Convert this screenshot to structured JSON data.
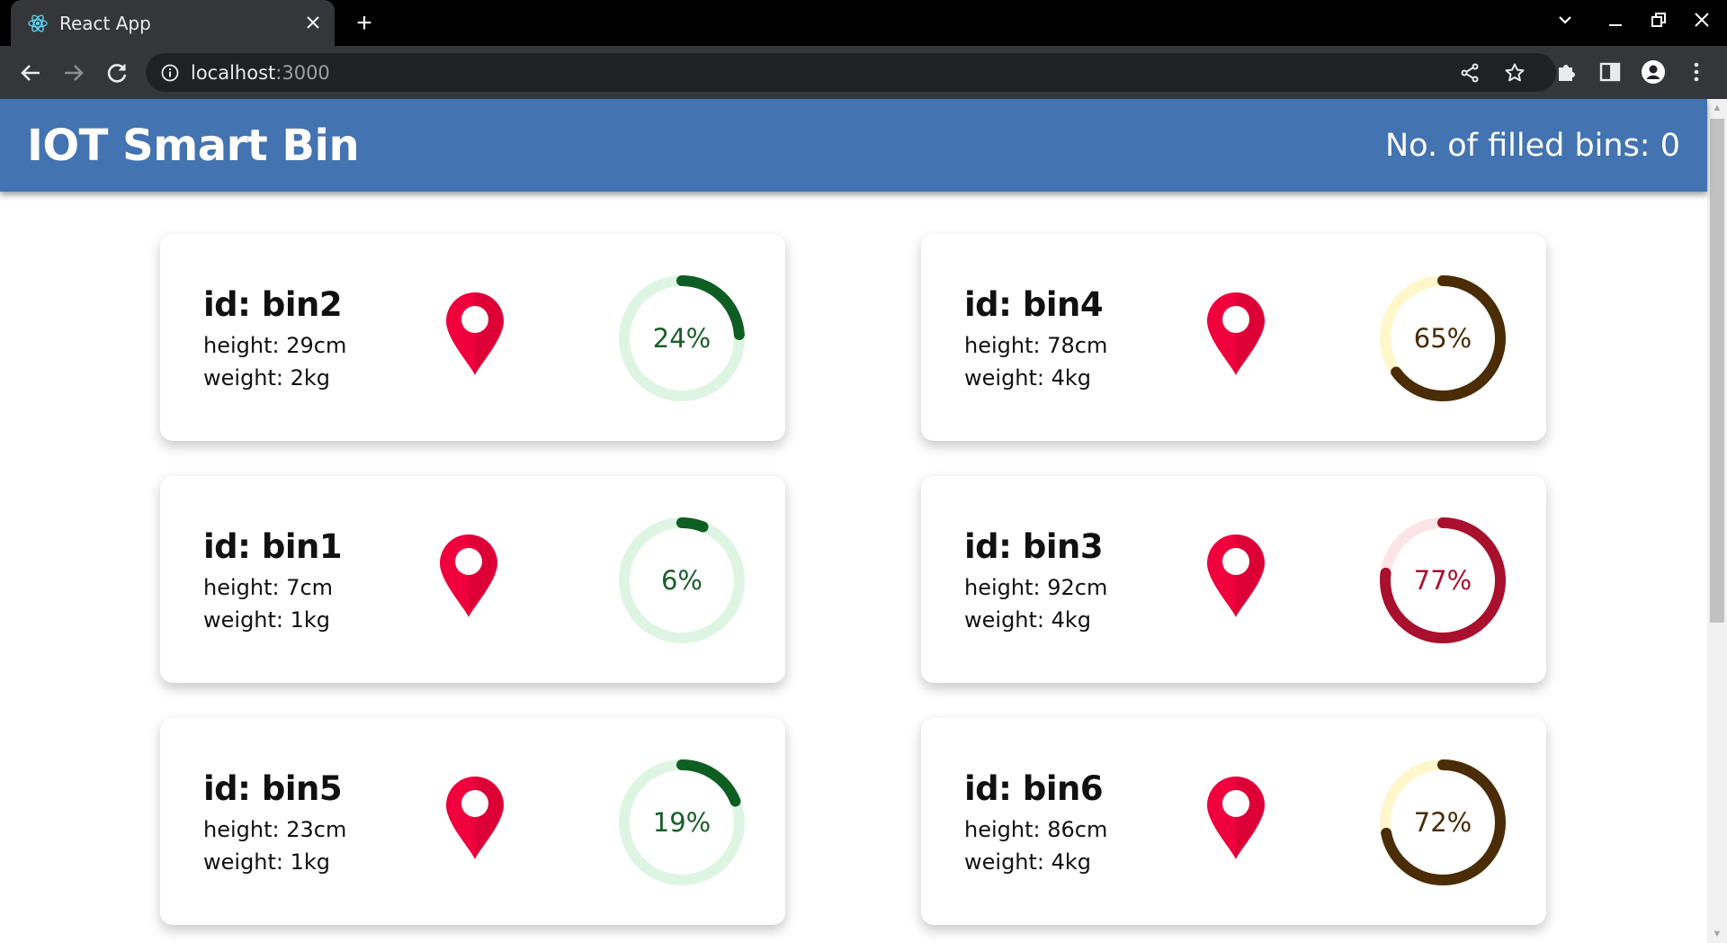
{
  "browser": {
    "tab_title": "React App",
    "new_tab_symbol": "+",
    "url_host": "localhost",
    "url_port": ":3000"
  },
  "header": {
    "title": "IOT Smart Bin",
    "filled_bins": "No. of filled bins: 0"
  },
  "bins": [
    {
      "id": "id: bin2",
      "height": "height: 29cm",
      "weight": "weight: 2kg",
      "fill_label": "24%",
      "fill": 24,
      "status": "low"
    },
    {
      "id": "id: bin4",
      "height": "height: 78cm",
      "weight": "weight: 4kg",
      "fill_label": "65%",
      "fill": 65,
      "status": "medium"
    },
    {
      "id": "id: bin1",
      "height": "height: 7cm",
      "weight": "weight: 1kg",
      "fill_label": "6%",
      "fill": 6,
      "status": "low"
    },
    {
      "id": "id: bin3",
      "height": "height: 92cm",
      "weight": "weight: 4kg",
      "fill_label": "77%",
      "fill": 77,
      "status": "high"
    },
    {
      "id": "id: bin5",
      "height": "height: 23cm",
      "weight": "weight: 1kg",
      "fill_label": "19%",
      "fill": 19,
      "status": "low"
    },
    {
      "id": "id: bin6",
      "height": "height: 86cm",
      "weight": "weight: 4kg",
      "fill_label": "72%",
      "fill": 72,
      "status": "medium"
    }
  ],
  "colors": {
    "header_bg": "#4373b1",
    "pin": "#f0003c",
    "low": {
      "track": "#dff5e3",
      "bar": "#0e5e24",
      "text": "#1a5e2b"
    },
    "medium": {
      "track": "#fff7cc",
      "bar": "#4a2c06",
      "text": "#4a2c06"
    },
    "high": {
      "track": "#fde4e7",
      "bar": "#a8102d",
      "text": "#a8102d"
    }
  },
  "icons": {
    "favicon": "react-logo-icon",
    "close": "close-icon",
    "pin": "location-pin-icon",
    "back": "back-arrow-icon",
    "forward": "forward-arrow-icon",
    "reload": "reload-icon",
    "info": "info-icon",
    "share": "share-icon",
    "star": "bookmark-star-icon",
    "extensions": "puzzle-icon",
    "side_panel": "side-panel-icon",
    "profile": "profile-icon",
    "menu": "kebab-menu-icon"
  }
}
